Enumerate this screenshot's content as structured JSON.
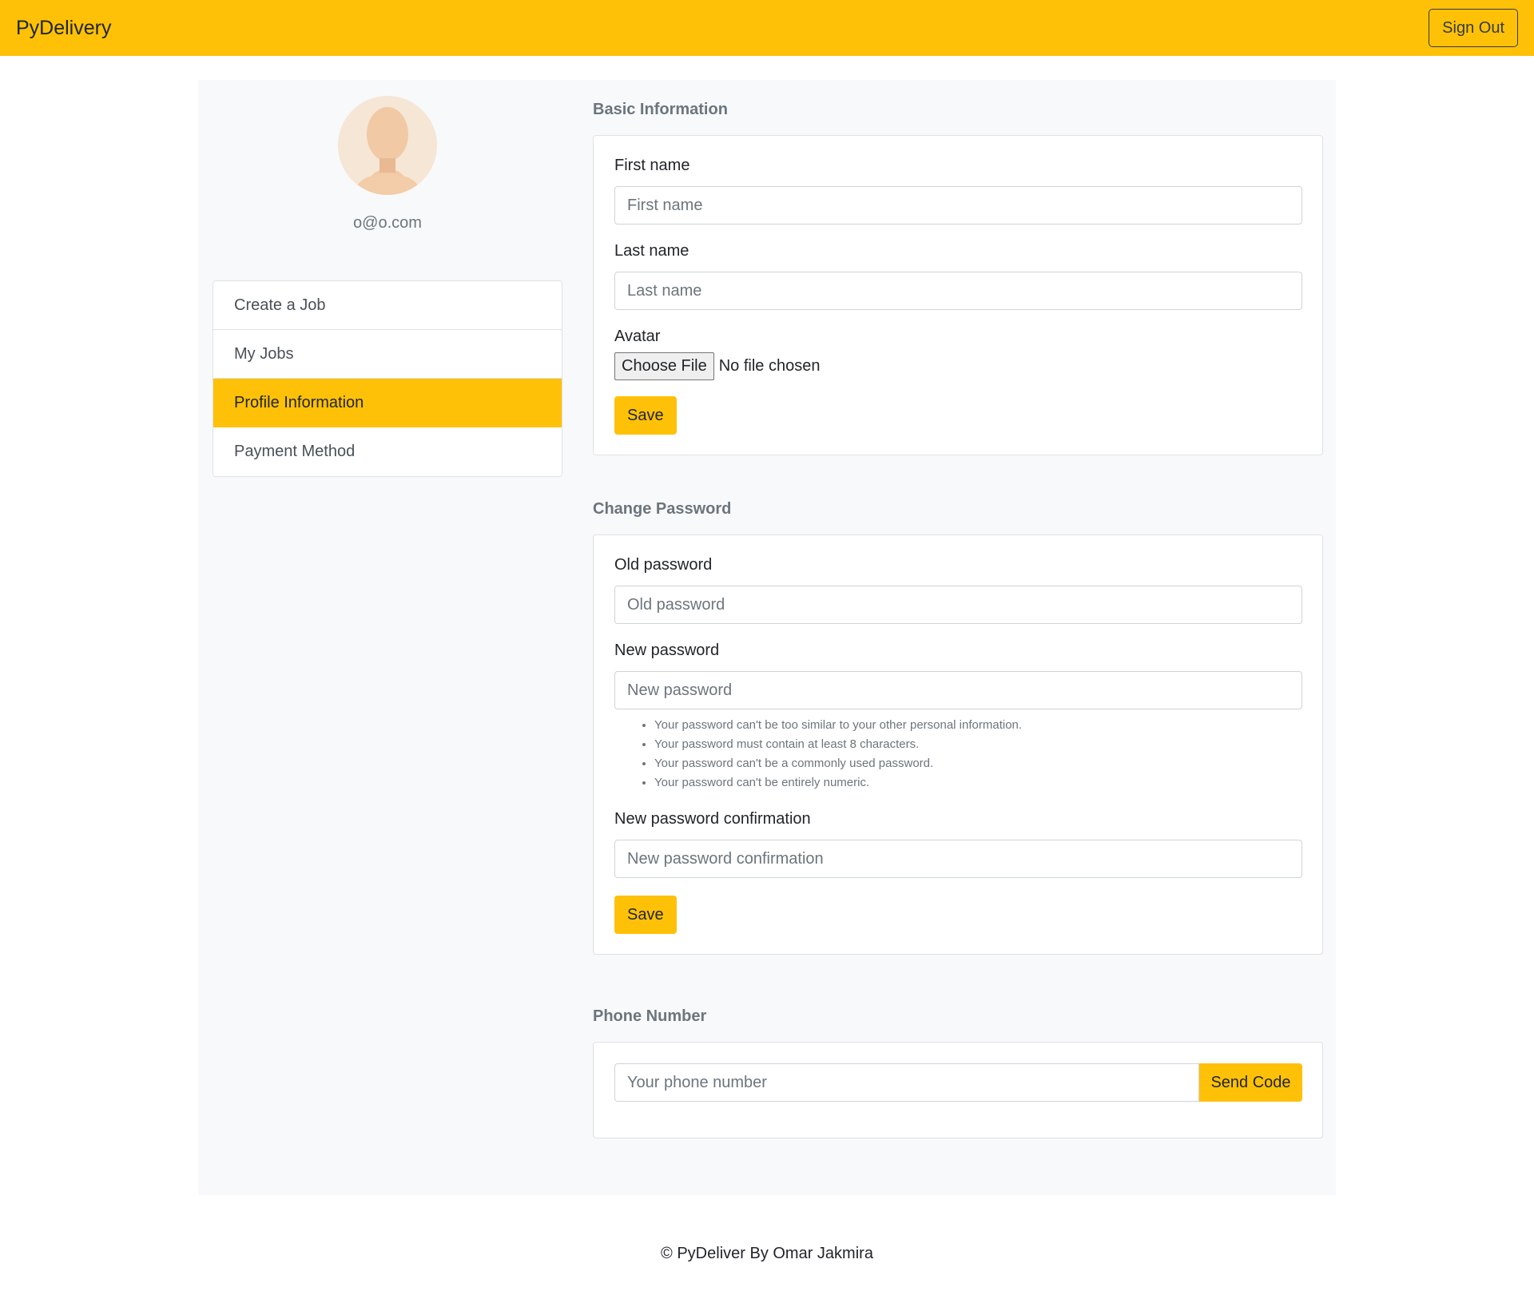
{
  "navbar": {
    "brand": "PyDelivery",
    "sign_out": "Sign Out"
  },
  "profile": {
    "email": "o@o.com"
  },
  "menu": {
    "items": [
      {
        "label": "Create a Job"
      },
      {
        "label": "My Jobs"
      },
      {
        "label": "Profile Information"
      },
      {
        "label": "Payment Method"
      }
    ]
  },
  "basic_info": {
    "title": "Basic Information",
    "first_name_label": "First name",
    "first_name_placeholder": "First name",
    "last_name_label": "Last name",
    "last_name_placeholder": "Last name",
    "avatar_label": "Avatar",
    "choose_file": "Choose File",
    "no_file": "No file chosen",
    "save": "Save"
  },
  "change_password": {
    "title": "Change Password",
    "old_label": "Old password",
    "old_placeholder": "Old password",
    "new_label": "New password",
    "new_placeholder": "New password",
    "help": [
      "Your password can't be too similar to your other personal information.",
      "Your password must contain at least 8 characters.",
      "Your password can't be a commonly used password.",
      "Your password can't be entirely numeric."
    ],
    "confirm_label": "New password confirmation",
    "confirm_placeholder": "New password confirmation",
    "save": "Save"
  },
  "phone": {
    "title": "Phone Number",
    "placeholder": "Your phone number",
    "send_code": "Send Code"
  },
  "footer": {
    "text": "© PyDeliver By Omar Jakmira"
  },
  "colors": {
    "accent": "#ffc107",
    "background": "#f8f9fa"
  }
}
